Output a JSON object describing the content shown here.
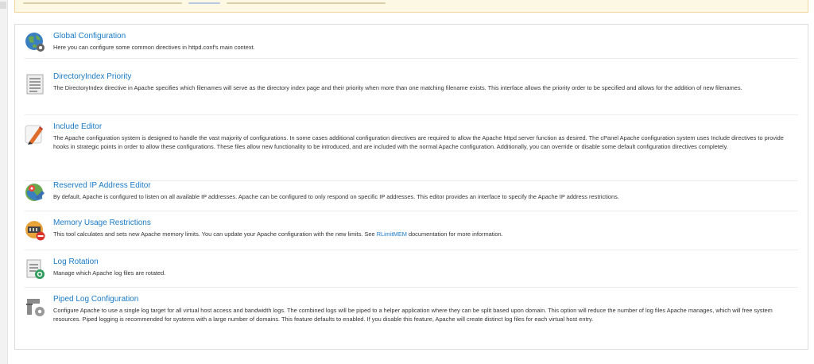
{
  "items": [
    {
      "title": "Global Configuration",
      "description": "Here you can configure some common directives in httpd.conf's main context.",
      "icon": "globe-gear-icon"
    },
    {
      "title": "DirectoryIndex Priority",
      "description": "The DirectoryIndex directive in Apache specifies which filenames will serve as the directory index page and their priority when more than one matching filename exists. This interface allows the priority order to be specified and allows for the addition of new filenames.",
      "icon": "list-document-icon"
    },
    {
      "title": "Include Editor",
      "description": "The Apache configuration system is designed to handle the vast majority of configurations. In some cases additional configuration directives are required to allow the Apache httpd server function as desired. The cPanel Apache configuration system uses Include directives to provide hooks in strategic points in order to allow these configurations. These files allow new functionality to be introduced, and are included with the normal Apache configuration. Additionally, you can override or disable some default configuration directives completely.",
      "icon": "pencil-edit-icon"
    },
    {
      "title": "Reserved IP Address Editor",
      "description": "By default, Apache is configured to listen on all available IP addresses. Apache can be configured to only respond on specific IP addresses. This editor provides an interface to specify the Apache IP address restrictions.",
      "icon": "map-pin-edit-icon"
    },
    {
      "title": "Memory Usage Restrictions",
      "description_before": "This tool calculates and sets new Apache memory limits. You can update your Apache configuration with the new limits. See ",
      "description_link": "RLimitMEM",
      "description_after": " documentation for more information.",
      "icon": "memory-restrict-icon"
    },
    {
      "title": "Log Rotation",
      "description": "Manage which Apache log files are rotated.",
      "icon": "log-rotate-icon"
    },
    {
      "title": "Piped Log Configuration",
      "description": "Configure Apache to use a single log target for all virtual host access and bandwidth logs. The combined logs will be piped to a helper application where they can be split based upon domain. This option will reduce the number of log files Apache manages, which will free system resources. Piped logging is recommended for systems with a large number of domains. This feature defaults to enabled. If you disable this feature, Apache will create distinct log files for each virtual host entry.",
      "icon": "pipe-gear-icon"
    }
  ],
  "colors": {
    "link": "#1a7ac8",
    "notice_bg": "#fcf8e3",
    "notice_border": "#f2d8a0"
  }
}
